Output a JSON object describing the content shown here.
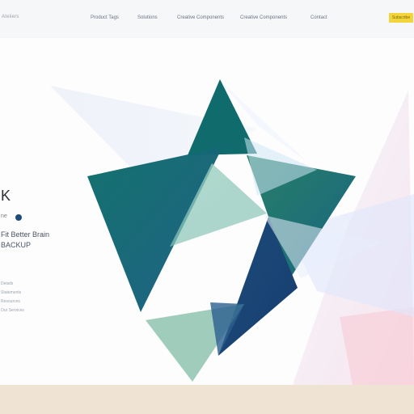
{
  "header": {
    "brand": "Ateliers",
    "nav": [
      "Product Tags",
      "Solutions",
      "Creative Components",
      "Creative Components",
      "Contact"
    ],
    "cta": "Subscribe"
  },
  "hero": {
    "title": "K",
    "subtitle": "ne",
    "lines": [
      "Fit Better Brain",
      "BACKUP"
    ],
    "links": [
      "Details",
      "Statements",
      "Resources",
      "Our Services"
    ]
  },
  "colors": {
    "accent": "#f4d43b",
    "primary": "#1d4c7a",
    "teal": "#127070",
    "green": "#1f7a61"
  }
}
